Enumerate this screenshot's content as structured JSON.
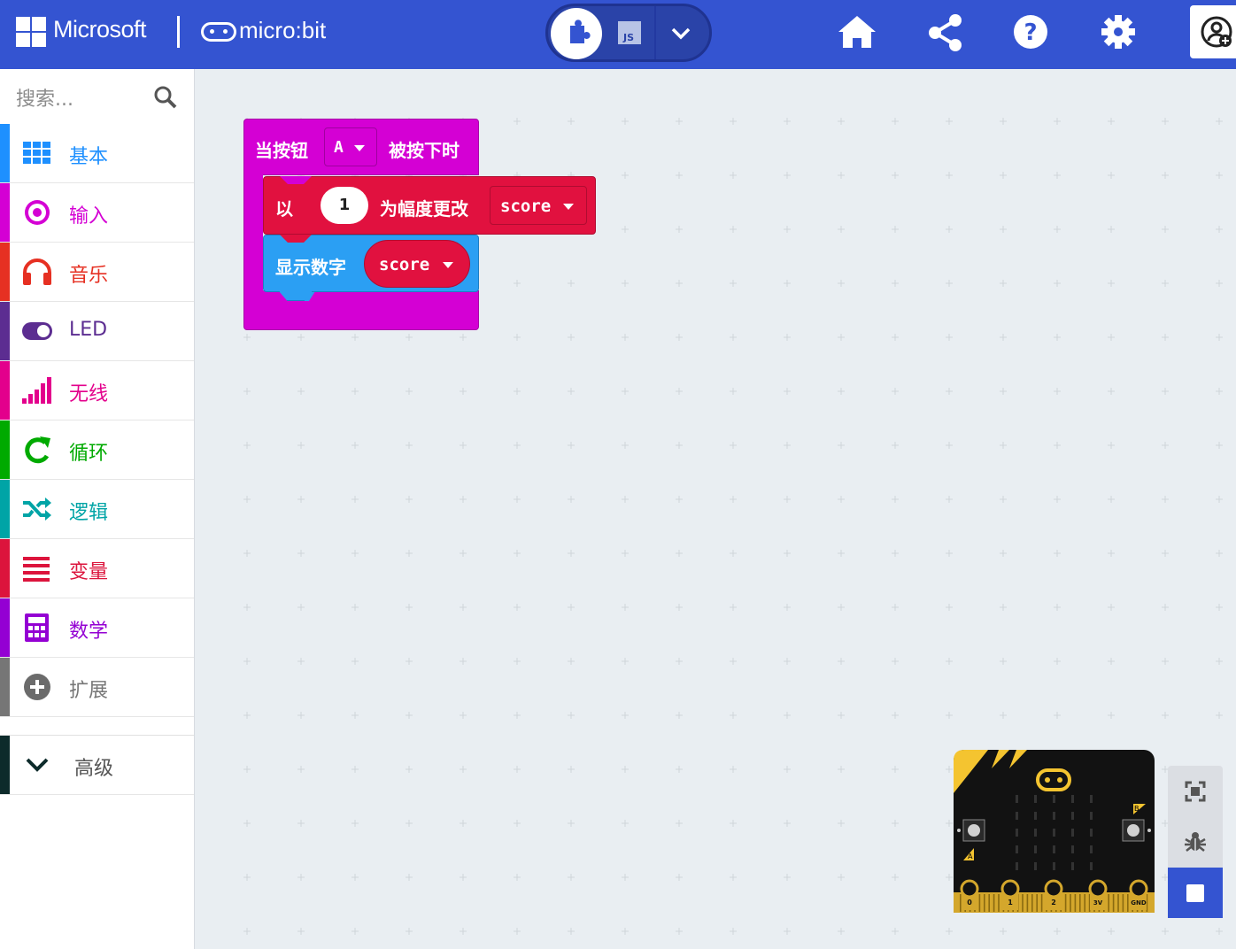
{
  "header": {
    "brand": "Microsoft",
    "product": "micro:bit",
    "mode_blocks_icon": "puzzle-icon",
    "mode_js_label": "JS",
    "actions": [
      "home-icon",
      "share-icon",
      "help-icon",
      "settings-icon",
      "user-icon"
    ]
  },
  "colors": {
    "header": "#3454d1",
    "basic": "#1e90ff",
    "input": "#d400d4",
    "music": "#e63022",
    "led": "#5c2d91",
    "radio": "#e3008c",
    "loops": "#00aa00",
    "logic": "#00a4a6",
    "variables": "#dc143c",
    "math": "#9400d3",
    "extensions": "#767676",
    "advanced": "#0d2b2b"
  },
  "sidebar": {
    "search_placeholder": "搜索...",
    "categories": [
      {
        "label": "基本",
        "icon": "grid-icon"
      },
      {
        "label": "输入",
        "icon": "target-icon"
      },
      {
        "label": "音乐",
        "icon": "headphones-icon"
      },
      {
        "label": "LED",
        "icon": "toggle-icon"
      },
      {
        "label": "无线",
        "icon": "signal-bars-icon"
      },
      {
        "label": "循环",
        "icon": "refresh-icon"
      },
      {
        "label": "逻辑",
        "icon": "shuffle-icon"
      },
      {
        "label": "变量",
        "icon": "list-icon"
      },
      {
        "label": "数学",
        "icon": "calculator-icon"
      },
      {
        "label": "扩展",
        "icon": "plus-circle-icon"
      }
    ],
    "advanced": {
      "label": "高级",
      "icon": "chevron-down-icon"
    }
  },
  "workspace": {
    "event_block": {
      "prefix": "当按钮",
      "button": "A",
      "suffix": "被按下时"
    },
    "change_block": {
      "prefix": "以",
      "value": "1",
      "middle": "为幅度更改",
      "variable": "score"
    },
    "show_block": {
      "label": "显示数字",
      "variable": "score"
    }
  },
  "simulator": {
    "pins": [
      "0",
      "1",
      "2",
      "3V",
      "GND"
    ],
    "button_a": "A",
    "button_b": "B",
    "tools": [
      "fullscreen-icon",
      "debug-icon",
      "stop-icon"
    ]
  }
}
